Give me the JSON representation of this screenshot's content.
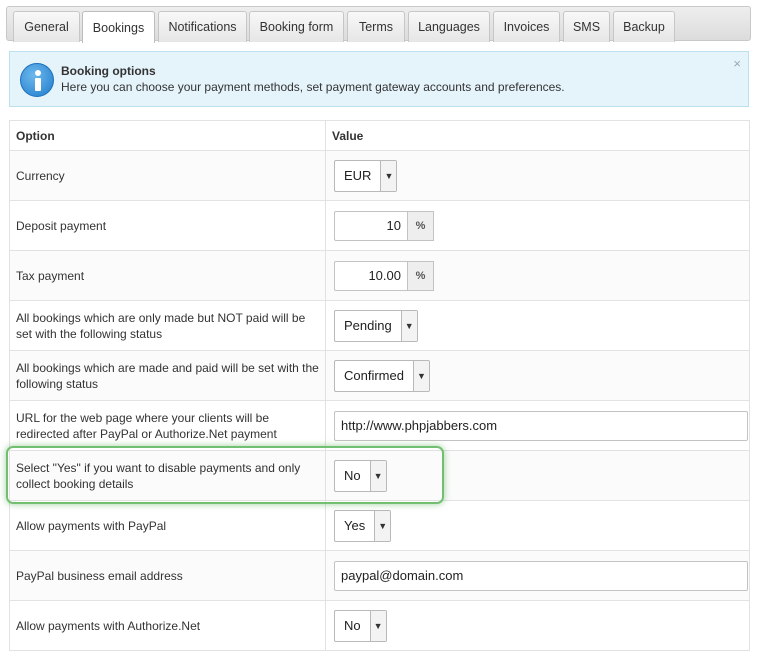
{
  "tabs": [
    {
      "label": "General",
      "active": false
    },
    {
      "label": "Bookings",
      "active": true
    },
    {
      "label": "Notifications",
      "active": false
    },
    {
      "label": "Booking form",
      "active": false
    },
    {
      "label": "Terms",
      "active": false
    },
    {
      "label": "Languages",
      "active": false
    },
    {
      "label": "Invoices",
      "active": false
    },
    {
      "label": "SMS",
      "active": false
    },
    {
      "label": "Backup",
      "active": false
    }
  ],
  "info": {
    "icon": "info-icon",
    "title": "Booking options",
    "text": "Here you can choose your payment methods, set payment gateway accounts and preferences.",
    "close": "×"
  },
  "table": {
    "headers": {
      "option": "Option",
      "value": "Value"
    },
    "rows": [
      {
        "label": "Currency",
        "type": "select",
        "value": "EUR"
      },
      {
        "label": "Deposit payment",
        "type": "number",
        "value": "10",
        "suffix": "%"
      },
      {
        "label": "Tax payment",
        "type": "number",
        "value": "10.00",
        "suffix": "%"
      },
      {
        "label": "All bookings which are only made but NOT paid will be set with the following status",
        "type": "select",
        "value": "Pending"
      },
      {
        "label": "All bookings which are made and paid will be set with the following status",
        "type": "select",
        "value": "Confirmed"
      },
      {
        "label": "URL for the web page where your clients will be redirected after PayPal or Authorize.Net payment",
        "type": "text",
        "value": "http://www.phpjabbers.com"
      },
      {
        "label": "Select \"Yes\" if you want to disable payments and only collect booking details",
        "type": "select",
        "value": "No",
        "highlighted": true
      },
      {
        "label": "Allow payments with PayPal",
        "type": "select",
        "value": "Yes"
      },
      {
        "label": "PayPal business email address",
        "type": "text",
        "value": "paypal@domain.com"
      },
      {
        "label": "Allow payments with Authorize.Net",
        "type": "select",
        "value": "No"
      }
    ]
  },
  "colors": {
    "highlight": "#72bf72",
    "info_bg": "#e5f4fb",
    "info_icon": "#1f7ccd"
  }
}
